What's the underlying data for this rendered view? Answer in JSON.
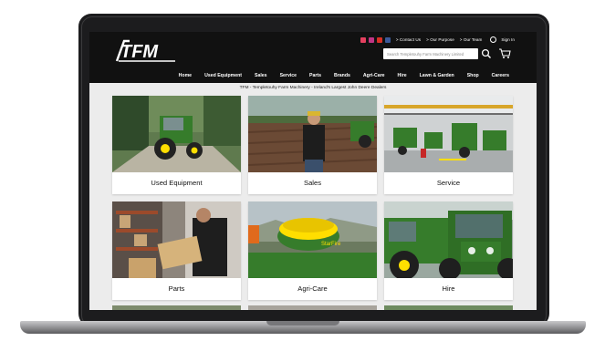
{
  "site": {
    "tagline": "TFM - Templetouhy Farm Machinery - Ireland's Largest John Deere Dealers"
  },
  "utility": {
    "links": [
      "> Contact Us",
      "> Our Purpose",
      "> Our Team"
    ],
    "signin": "Sign In",
    "social_icons": [
      "youtube-icon",
      "instagram-icon",
      "linkedin-icon",
      "facebook-icon"
    ]
  },
  "search": {
    "placeholder": "Search Templetouhy Farm Machinery Limited"
  },
  "nav": {
    "items": [
      "Home",
      "Used Equipment",
      "Sales",
      "Service",
      "Parts",
      "Brands",
      "Agri-Care",
      "Hire",
      "Lawn & Garden",
      "Shop",
      "Careers"
    ]
  },
  "cards": [
    {
      "label": "Used Equipment",
      "photo_icon": "tractor-photo"
    },
    {
      "label": "Sales",
      "photo_icon": "salesman-field-photo"
    },
    {
      "label": "Service",
      "photo_icon": "workshop-photo"
    },
    {
      "label": "Parts",
      "photo_icon": "parts-boxes-photo"
    },
    {
      "label": "Agri-Care",
      "photo_icon": "gps-receiver-photo"
    },
    {
      "label": "Hire",
      "photo_icon": "tractor-front-photo"
    }
  ],
  "colors": {
    "header_bg": "#111111",
    "deere_green": "#367c2b",
    "deere_yellow": "#ffde00",
    "page_bg": "#ececec"
  }
}
